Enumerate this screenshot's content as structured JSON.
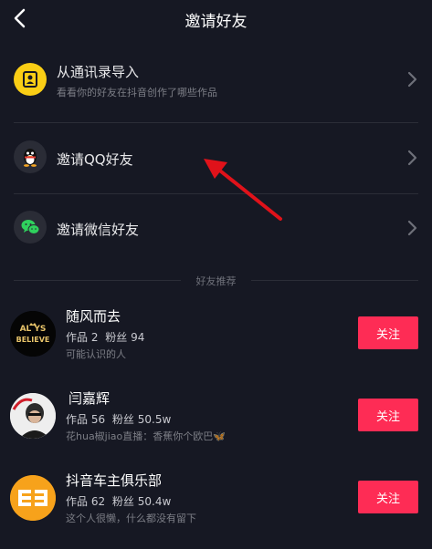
{
  "header": {
    "title": "邀请好友"
  },
  "options": [
    {
      "label": "从通讯录导入",
      "sub": "看看你的好友在抖音创作了哪些作品"
    },
    {
      "label": "邀请QQ好友"
    },
    {
      "label": "邀请微信好友"
    }
  ],
  "section": {
    "title": "好友推荐"
  },
  "follow_label": "关注",
  "users": [
    {
      "name": "随风而去",
      "works": "作品 2",
      "fans": "粉丝 94",
      "desc": "可能认识的人",
      "avatar_text_1": "AL  YS",
      "avatar_text_2": "BELIEVE"
    },
    {
      "name": "闫嘉辉",
      "works": "作品 56",
      "fans": "粉丝 50.5w",
      "desc": "花hua椒jiao直播：香蕉你个欧巴🦋"
    },
    {
      "name": "抖音车主俱乐部",
      "works": "作品 62",
      "fans": "粉丝 50.4w",
      "desc": "这个人很懒，什么都没有留下"
    }
  ],
  "colors": {
    "background": "#161823",
    "accent": "#fe2c55",
    "contacts_icon": "#face15",
    "wechat_icon": "#2fd15d"
  },
  "icons": [
    "back-arrow-icon",
    "contacts-icon",
    "qq-penguin-icon",
    "wechat-icon",
    "chevron-right-icon"
  ]
}
